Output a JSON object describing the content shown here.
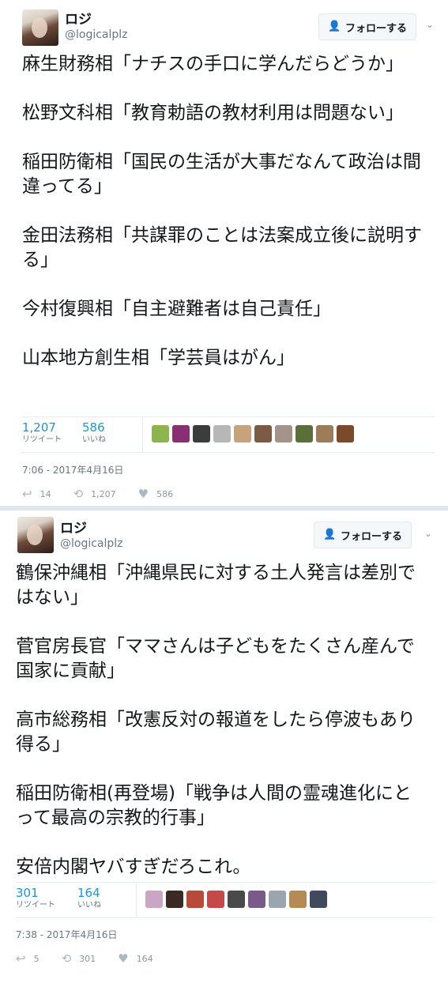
{
  "tweets": [
    {
      "name": "ロジ",
      "handle": "@logicalplz",
      "follow_label": "フォローする",
      "text": "麻生財務相「ナチスの手口に学んだらどうか」\n\n松野文科相「教育勅語の教材利用は問題ない」\n\n稲田防衛相「国民の生活が大事だなんて政治は間違ってる」\n\n金田法務相「共謀罪のことは法案成立後に説明する」\n\n今村復興相「自主避難者は自己責任」\n\n山本地方創生相「学芸員はがん」",
      "retweets": "1,207",
      "retweets_label": "リツイート",
      "likes": "586",
      "likes_label": "いいね",
      "liker_colors": [
        "#8fb34e",
        "#8a2f74",
        "#3c3c3c",
        "#b7b7b7",
        "#c7a27a",
        "#7b5b43",
        "#a3938a",
        "#5c6f39",
        "#9b7d5a",
        "#7a4a2a"
      ],
      "timestamp": "7:06 - 2017年4月16日",
      "replies": "14",
      "retweet_count_action": "1,207",
      "like_count_action": "586"
    },
    {
      "name": "ロジ",
      "handle": "@logicalplz",
      "follow_label": "フォローする",
      "text": "鶴保沖縄相「沖縄県民に対する土人発言は差別ではない」\n\n菅官房長官「ママさんは子どもをたくさん産んで国家に貢献」\n\n高市総務相「改憲反対の報道をしたら停波もあり得る」\n\n稲田防衛相(再登場)「戦争は人間の霊魂進化にとって最高の宗教的行事」\n\n安倍内閣ヤバすぎだろこれ。",
      "retweets": "301",
      "retweets_label": "リツイート",
      "likes": "164",
      "likes_label": "いいね",
      "liker_colors": [
        "#c9a6c4",
        "#3a2a22",
        "#b84a3a",
        "#c44a4a",
        "#4a4a4a",
        "#7a5a8a",
        "#9aa5b0",
        "#b58a55",
        "#3f4a5c"
      ],
      "timestamp": "7:38 - 2017年4月16日",
      "replies": "5",
      "retweet_count_action": "301",
      "like_count_action": "164"
    }
  ],
  "icons": {
    "follow": "person-plus-icon",
    "chevron": "chevron-down-icon",
    "reply": "reply-icon",
    "retweet": "retweet-icon",
    "like": "heart-icon"
  },
  "colors": {
    "accent": "#1da1f2",
    "stat_number": "#1b95e0",
    "muted": "#657786"
  }
}
